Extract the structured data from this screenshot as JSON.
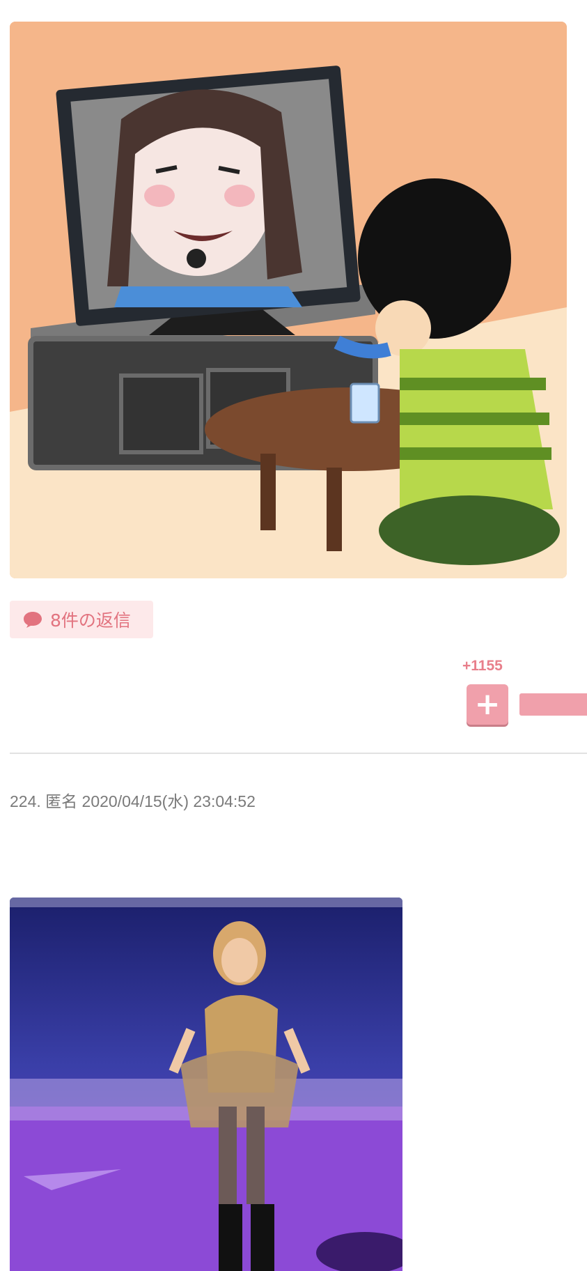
{
  "thread": {
    "illustration": {
      "icon": "tv-watching-illustration"
    },
    "replies": {
      "label": "8件の返信",
      "icon": "speech-bubble-icon"
    },
    "vote": {
      "plus_count": "+1155",
      "plus_symbol": "+"
    },
    "comment": {
      "meta": "224. 匿名 2020/04/15(水) 23:04:52",
      "photo": {
        "icon": "concert-performer-photo"
      }
    }
  },
  "colors": {
    "accent": "#e2737f",
    "badge_bg": "#fde9ea",
    "vote_button": "#f0a0ab",
    "meta_text": "#7a7a7a"
  }
}
